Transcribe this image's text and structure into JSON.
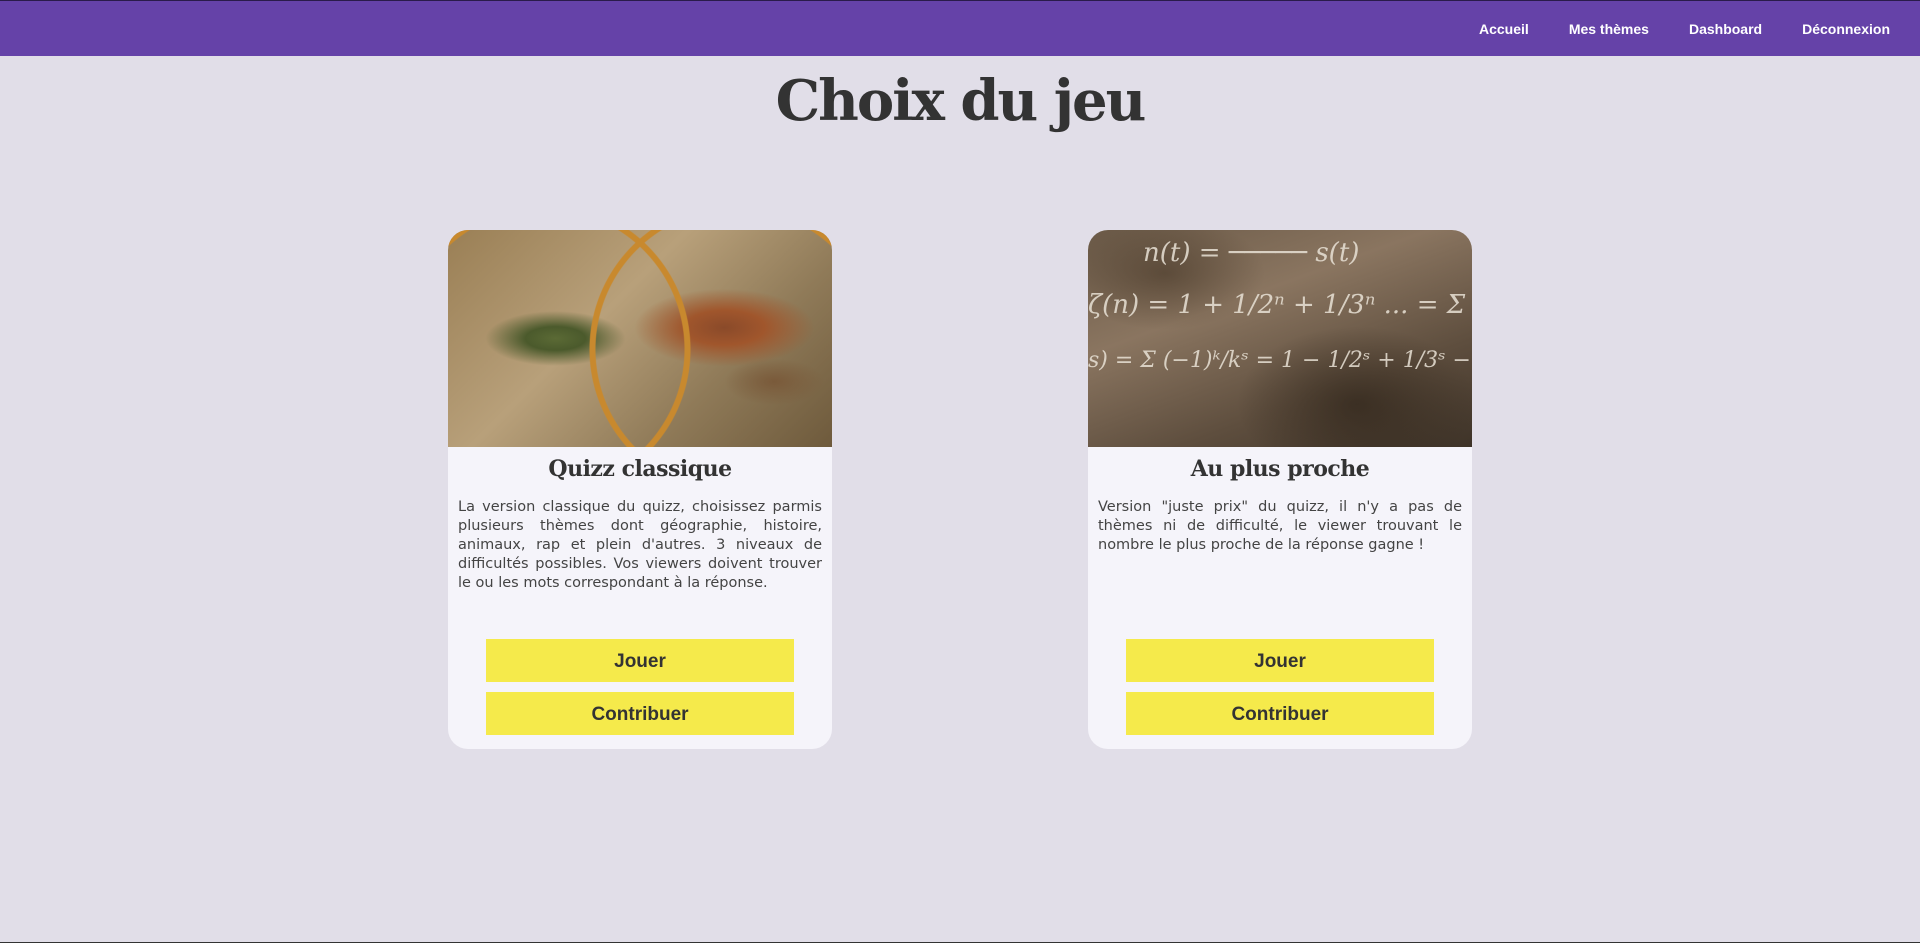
{
  "nav": {
    "items": [
      {
        "label": "Accueil"
      },
      {
        "label": "Mes thèmes"
      },
      {
        "label": "Dashboard"
      },
      {
        "label": "Déconnexion"
      }
    ]
  },
  "page_title": "Choix du jeu",
  "cards": [
    {
      "title": "Quizz classique",
      "description": "La version classique du quizz, choisissez parmis plusieurs thèmes dont géographie, histoire, animaux, rap et plein d'autres. 3 niveaux de difficultés possibles. Vos viewers doivent trouver le ou les mots correspondant à la réponse.",
      "play_label": "Jouer",
      "contribute_label": "Contribuer",
      "image": "world-map-image"
    },
    {
      "title": "Au plus proche",
      "description": "Version \"juste prix\" du quizz, il n'y a pas de thèmes ni de difficulté, le viewer trouvant le nombre le plus proche de la réponse gagne !",
      "play_label": "Jouer",
      "contribute_label": "Contribuer",
      "image": "math-formulas-image"
    }
  ],
  "colors": {
    "navbar": "#6542a8",
    "background": "#e1dee8",
    "card": "#f5f4fa",
    "button": "#f5ea4b"
  }
}
